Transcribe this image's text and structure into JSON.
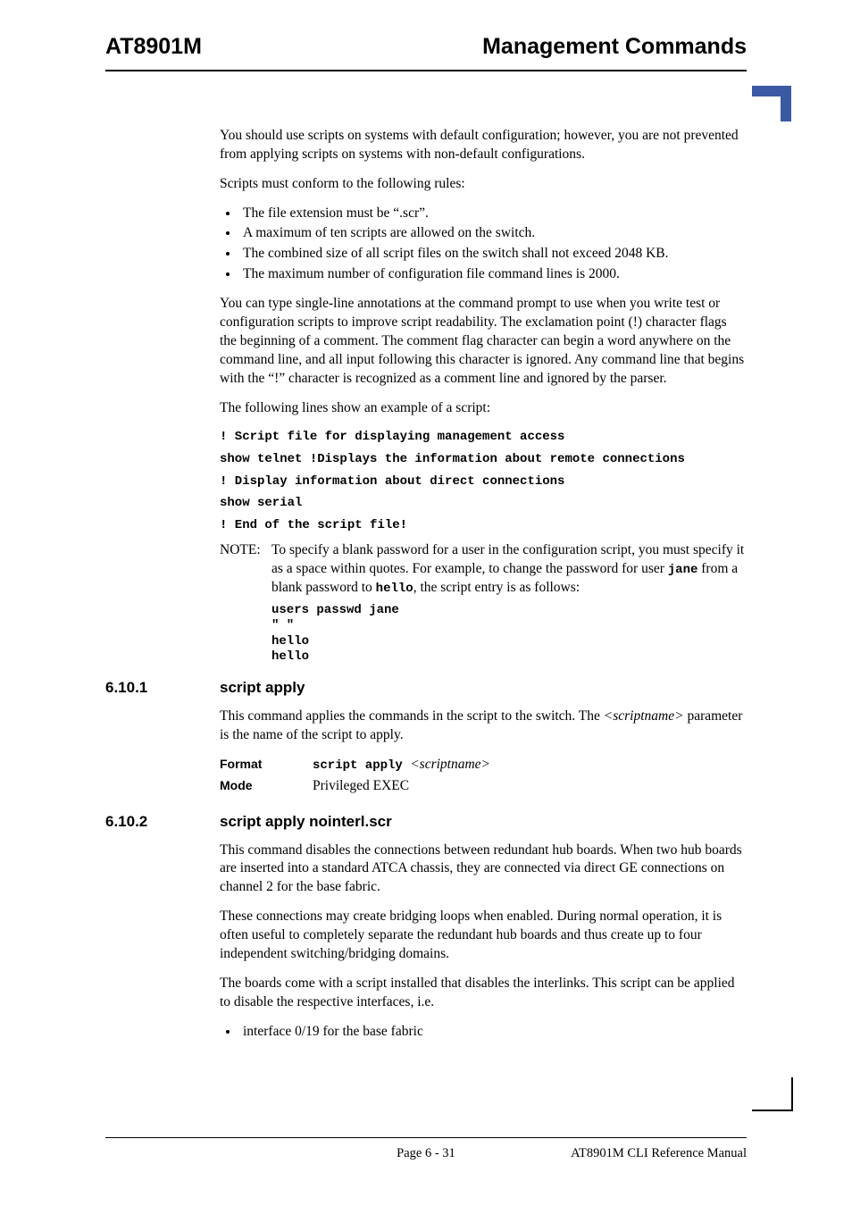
{
  "header": {
    "left": "AT8901M",
    "right": "Management Commands"
  },
  "para1": "You should use scripts on systems with default configuration; however, you are not prevented from applying scripts on systems with non-default configurations.",
  "para2": "Scripts must conform to the following rules:",
  "rules": [
    "The file extension must be “.scr”.",
    "A maximum of ten scripts are allowed on the switch.",
    "The combined size of all script files on the switch shall not exceed 2048 KB.",
    "The maximum number of configuration file command lines is 2000."
  ],
  "para3": "You can type single-line annotations at the command prompt to use when you write test or configuration scripts to improve script readability. The exclamation point (!) character flags the beginning of a comment. The comment flag character can begin a word anywhere on the command line, and all input following this character is ignored. Any command line that begins with the “!” character is recognized as a comment line and ignored by the parser.",
  "para4": "The following lines show an example of a script:",
  "script_lines": [
    "! Script file for displaying management access",
    "show telnet !Displays the information about remote connections",
    "! Display information about direct connections",
    "show serial",
    "! End of the script file!"
  ],
  "note": {
    "label": "NOTE:",
    "body_pre": "To specify a blank password for a user in the configuration script, you must specify it as a space within quotes. For example, to change the password for user ",
    "user": "jane",
    "body_mid": " from a blank password to ",
    "pass": "hello",
    "body_post": ", the script entry is as follows:",
    "code": "users passwd jane\n\" \"\nhello\nhello"
  },
  "sections": [
    {
      "num": "6.10.1",
      "title": "script apply",
      "para": "This command applies the commands in the script to the switch. The ",
      "para_italic": "<scriptname>",
      "para_tail": " parameter is the name of the script to apply.",
      "format_label": "Format",
      "format_cmd": "script apply ",
      "format_arg": "<scriptname>",
      "mode_label": "Mode",
      "mode_value": "Privileged EXEC"
    },
    {
      "num": "6.10.2",
      "title": "script apply nointerl.scr",
      "paras": [
        "This command disables the connections between redundant hub boards. When two hub boards are inserted into a standard ATCA chassis, they are connected via direct GE connections on channel 2 for the base fabric.",
        "These connections may create bridging loops when enabled. During normal operation, it is often useful to completely separate the redundant hub boards and thus create up to four independent switching/bridging domains.",
        "The boards come with a script installed that disables the interlinks. This script can be applied to disable the respective interfaces, i.e."
      ],
      "bullets": [
        "interface 0/19 for the base fabric"
      ]
    }
  ],
  "footer": {
    "center": "Page 6 - 31",
    "right": "AT8901M CLI Reference Manual"
  }
}
